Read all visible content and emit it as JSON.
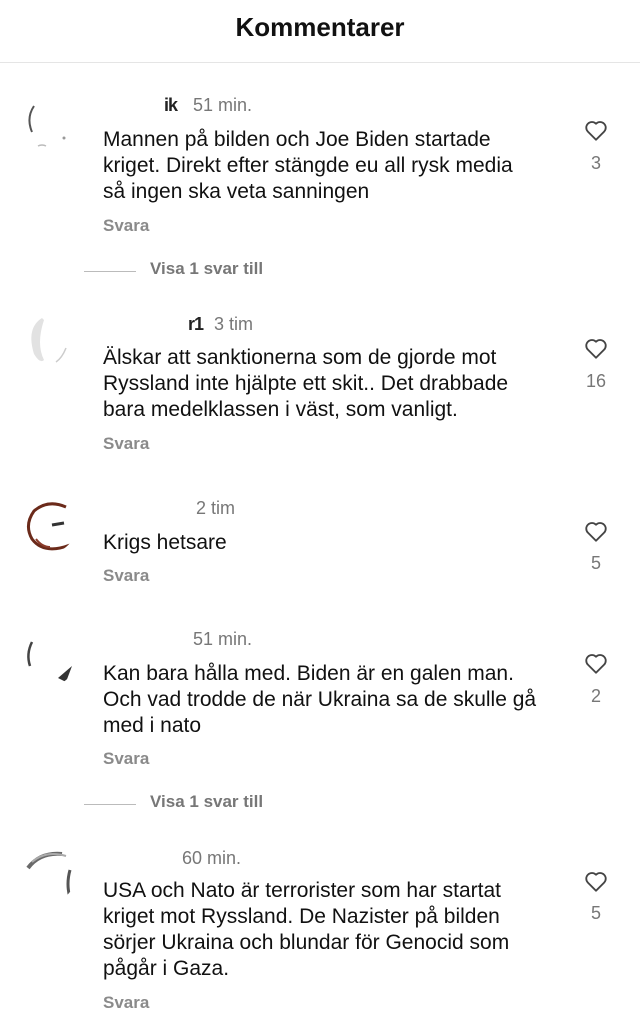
{
  "header": {
    "title": "Kommentarer"
  },
  "reply_label": "Svara",
  "comments": [
    {
      "username": "ik",
      "time": "51 min.",
      "text_lines": [
        "Mannen på bilden och Joe Biden startade",
        "kriget. Direkt efter stängde eu all rysk media",
        "så ingen ska veta sanningen"
      ],
      "likes": "3",
      "more_replies": "Visa 1 svar till"
    },
    {
      "username": "r1",
      "time": "3 tim",
      "text_lines": [
        "Älskar att sanktionerna som de gjorde mot",
        "Ryssland inte hjälpte ett skit.. Det drabbade",
        "bara medelklassen i väst, som vanligt."
      ],
      "likes": "16"
    },
    {
      "username": "",
      "time": "2 tim",
      "text_lines": [
        "Krigs hetsare"
      ],
      "likes": "5"
    },
    {
      "username": "",
      "time": "51 min.",
      "text_lines": [
        "Kan bara hålla med. Biden är en galen man.",
        "Och vad trodde de när Ukraina sa de skulle gå",
        "med i nato"
      ],
      "likes": "2",
      "more_replies": "Visa 1 svar till"
    },
    {
      "username": "",
      "time": "60 min.",
      "text_lines": [
        "USA och Nato är terrorister som har startat",
        "kriget mot Ryssland. De Nazister på bilden",
        "sörjer Ukraina och blundar för Genocid som",
        "pågår i Gaza."
      ],
      "likes": "5"
    }
  ],
  "icons": {
    "like": "heart-outline-icon"
  }
}
